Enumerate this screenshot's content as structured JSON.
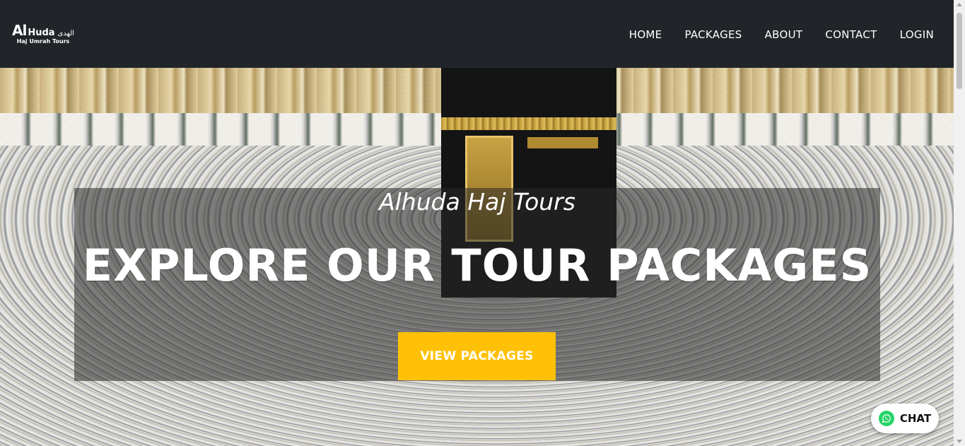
{
  "brand": {
    "logo_al": "Al",
    "logo_huda": "Huda",
    "logo_arabic": "الهدى",
    "logo_sub": "Haj Umrah Tours"
  },
  "nav": {
    "items": [
      {
        "label": "HOME"
      },
      {
        "label": "PACKAGES"
      },
      {
        "label": "ABOUT"
      },
      {
        "label": "CONTACT"
      },
      {
        "label": "LOGIN"
      }
    ]
  },
  "hero": {
    "tagline": "Alhuda Haj Tours",
    "headline": "EXPLORE OUR TOUR PACKAGES",
    "cta_label": "VIEW PACKAGES"
  },
  "chat": {
    "label": "CHAT",
    "icon": "whatsapp-icon"
  },
  "colors": {
    "navbar_bg": "#212529",
    "cta_bg": "#ffc107",
    "whatsapp_green": "#25d366"
  }
}
